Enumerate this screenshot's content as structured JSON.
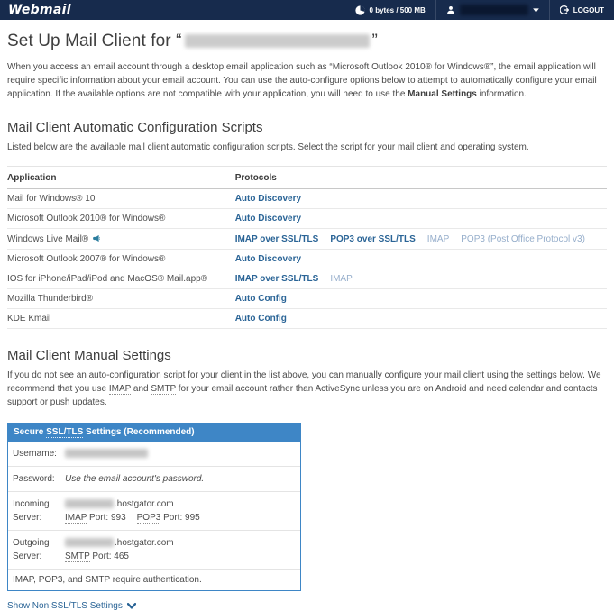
{
  "colors": {
    "topbar_bg": "#172b4d",
    "panel_blue": "#3e86c6",
    "link_bold": "#2a6496",
    "link_muted": "#96aecb"
  },
  "header": {
    "logo": "Webmail",
    "disk_usage": "0 bytes / 500 MB",
    "logout_label": "LOGOUT"
  },
  "page": {
    "title_prefix": "Set Up Mail Client for “",
    "title_suffix": "”",
    "intro_part1": "When you access an email account through a desktop email application such as “Microsoft Outlook 2010® for Windows®”, the email application will require specific information about your email account. You can use the auto-configure options below to attempt to automatically configure your email application. If the available options are not compatible with your application, you will need to use the ",
    "intro_bold": "Manual Settings",
    "intro_part2": " information."
  },
  "auto_section": {
    "heading": "Mail Client Automatic Configuration Scripts",
    "subtext": "Listed below are the available mail client automatic configuration scripts. Select the script for your mail client and operating system.",
    "columns": [
      "Application",
      "Protocols"
    ],
    "rows": [
      {
        "application": "Mail for Windows® 10",
        "has_icon": false,
        "protocols": [
          {
            "label": "Auto Discovery",
            "style": "bold"
          }
        ]
      },
      {
        "application": "Microsoft Outlook 2010® for Windows®",
        "has_icon": false,
        "protocols": [
          {
            "label": "Auto Discovery",
            "style": "bold"
          }
        ]
      },
      {
        "application": "Windows Live Mail®",
        "has_icon": true,
        "protocols": [
          {
            "label": "IMAP over SSL/TLS",
            "style": "bold"
          },
          {
            "label": "POP3 over SSL/TLS",
            "style": "bold"
          },
          {
            "label": "IMAP",
            "style": "muted"
          },
          {
            "label": "POP3 (Post Office Protocol v3)",
            "style": "muted"
          }
        ]
      },
      {
        "application": "Microsoft Outlook 2007® for Windows®",
        "has_icon": false,
        "protocols": [
          {
            "label": "Auto Discovery",
            "style": "bold"
          }
        ]
      },
      {
        "application": "IOS for iPhone/iPad/iPod and MacOS® Mail.app®",
        "has_icon": false,
        "protocols": [
          {
            "label": "IMAP over SSL/TLS",
            "style": "bold"
          },
          {
            "label": "IMAP",
            "style": "muted"
          }
        ]
      },
      {
        "application": "Mozilla Thunderbird®",
        "has_icon": false,
        "protocols": [
          {
            "label": "Auto Config",
            "style": "bold"
          }
        ]
      },
      {
        "application": "KDE Kmail",
        "has_icon": false,
        "protocols": [
          {
            "label": "Auto Config",
            "style": "bold"
          }
        ]
      }
    ]
  },
  "manual_section": {
    "heading": "Mail Client Manual Settings",
    "intro_p1": "If you do not see an auto-configuration script for your client in the list above, you can manually configure your mail client using the settings below. We recommend that you use ",
    "intro_abbr1": "IMAP",
    "intro_mid": " and ",
    "intro_abbr2": "SMTP",
    "intro_p2": " for your email account rather than ActiveSync unless you are on Android and need calendar and contacts support or push updates.",
    "panel": {
      "title_pre": "Secure ",
      "title_abbr": "SSL/TLS",
      "title_post": " Settings (Recommended)",
      "username_label": "Username:",
      "password_label": "Password:",
      "password_value": "Use the email account's password.",
      "incoming_label": "Incoming Server:",
      "incoming_domain": ".hostgator.com",
      "incoming_ports": [
        {
          "abbr": "IMAP",
          "rest": " Port: 993"
        },
        {
          "abbr": "POP3",
          "rest": " Port: 995"
        }
      ],
      "outgoing_label": "Outgoing Server:",
      "outgoing_domain": ".hostgator.com",
      "outgoing_ports": [
        {
          "abbr": "SMTP",
          "rest": " Port: 465"
        }
      ],
      "note": "IMAP, POP3, and SMTP require authentication."
    },
    "show_non_ssl_label": "Show Non SSL/TLS Settings"
  }
}
